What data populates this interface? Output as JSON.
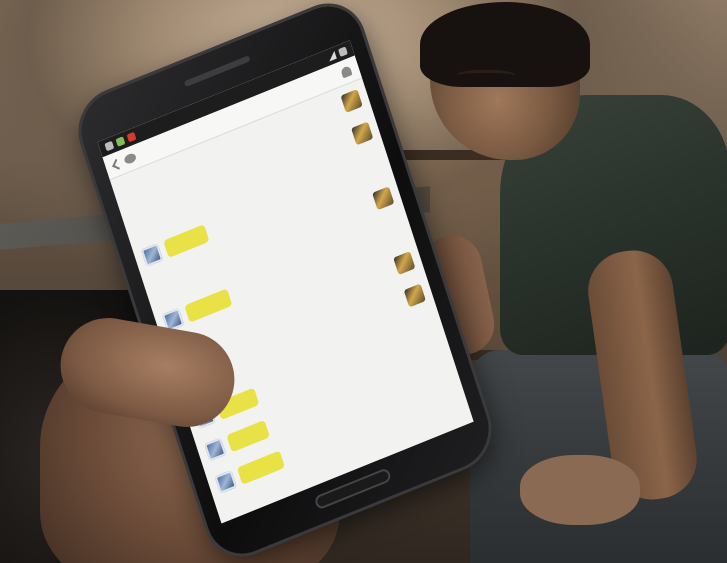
{
  "colors": {
    "bubble": "#e8e246",
    "screen": "#f2f2f1",
    "phone_body": "#0d0d0e"
  },
  "phone": {
    "status_bar": {
      "icons": [
        "message-icon",
        "app-icon",
        "red-app-icon",
        "signal-icon",
        "battery-icon"
      ]
    },
    "title_bar": {
      "icons": [
        "back-icon",
        "chat-icon",
        "person-icon"
      ]
    },
    "messages": [
      {
        "side": "right",
        "bubble_width_fraction": 0
      },
      {
        "side": "right",
        "bubble_width_fraction": 0
      },
      {
        "side": "left",
        "bubble_width_fraction": 0.16
      },
      {
        "side": "right",
        "bubble_width_fraction": 0
      },
      {
        "side": "left",
        "bubble_width_fraction": 0.17
      },
      {
        "side": "right",
        "bubble_width_fraction": 0
      },
      {
        "side": "right",
        "bubble_width_fraction": 0
      },
      {
        "side": "left",
        "bubble_width_fraction": 0.15
      },
      {
        "side": "left",
        "bubble_width_fraction": 0.15
      },
      {
        "side": "left",
        "bubble_width_fraction": 0.17
      }
    ]
  }
}
